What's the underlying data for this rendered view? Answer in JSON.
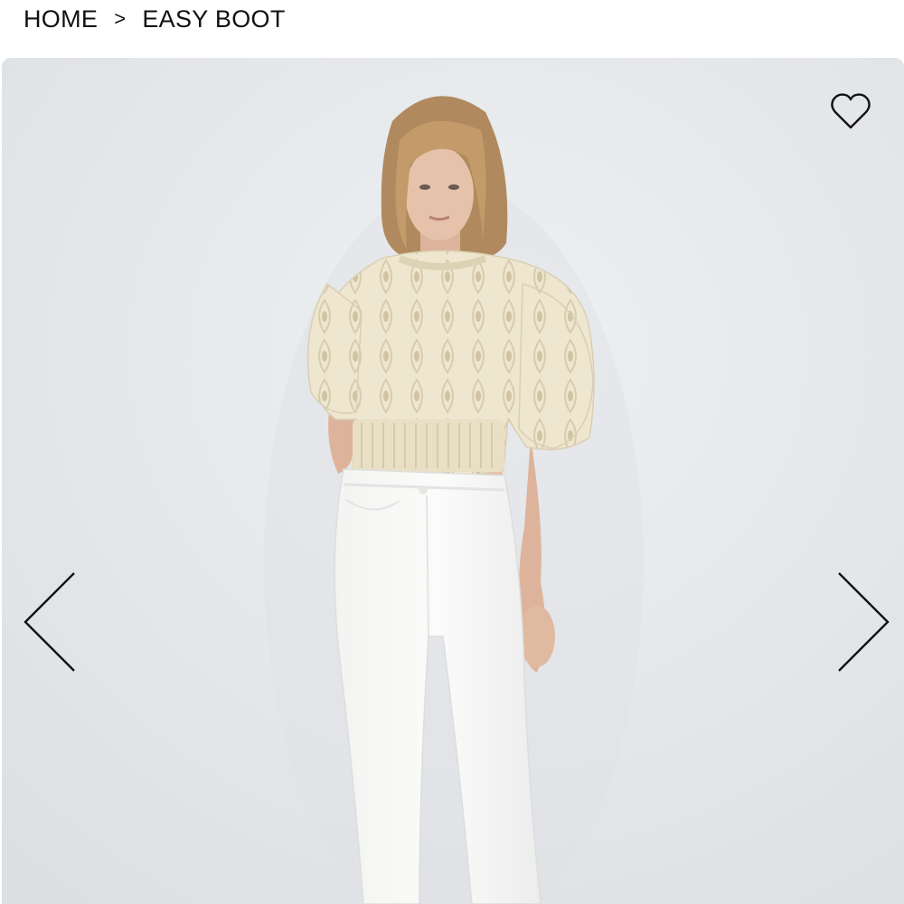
{
  "breadcrumb": {
    "home": "HOME",
    "separator": ">",
    "current": "EASY BOOT"
  },
  "gallery": {
    "background": "#e7e9eb",
    "image_alt": "Model wearing cream pointelle knit short-sleeve sweater and white flared jeans",
    "wishlist_icon": "heart-outline-icon",
    "prev_icon": "chevron-left-icon",
    "next_icon": "chevron-right-icon"
  },
  "colors": {
    "text": "#111111",
    "sweater": "#efe6cf",
    "jeans": "#f8f8f6",
    "skin": "#e2bba3",
    "hair": "#b08a5e"
  }
}
